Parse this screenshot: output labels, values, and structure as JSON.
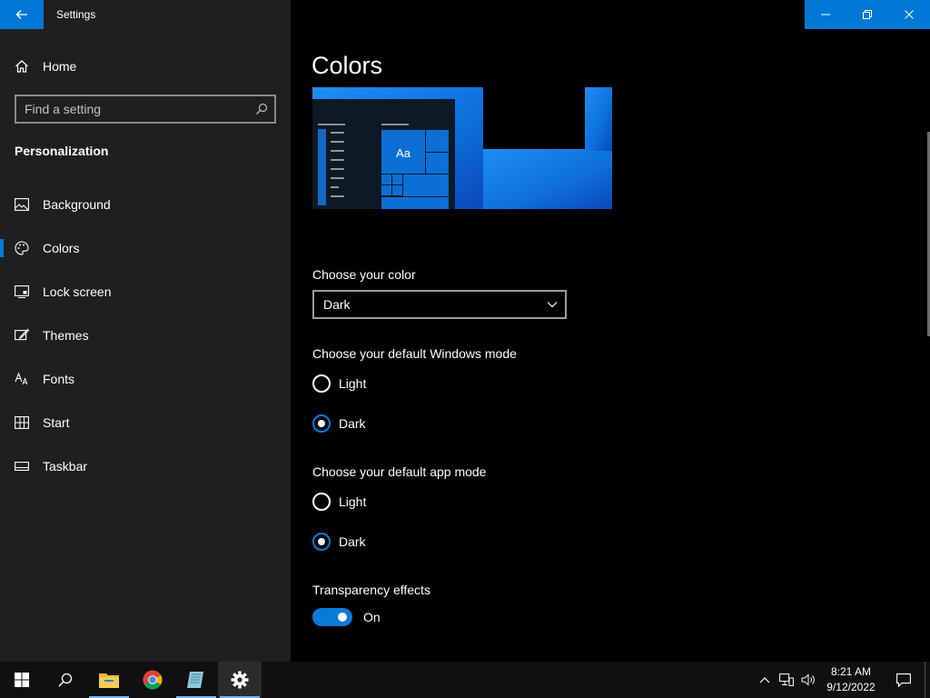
{
  "app": {
    "title": "Settings"
  },
  "sidebar": {
    "home_label": "Home",
    "search_placeholder": "Find a setting",
    "section_title": "Personalization",
    "items": [
      {
        "label": "Background",
        "icon": "picture-icon"
      },
      {
        "label": "Colors",
        "icon": "palette-icon",
        "active": true
      },
      {
        "label": "Lock screen",
        "icon": "lock-screen-icon"
      },
      {
        "label": "Themes",
        "icon": "brush-icon"
      },
      {
        "label": "Fonts",
        "icon": "font-icon"
      },
      {
        "label": "Start",
        "icon": "start-icon"
      },
      {
        "label": "Taskbar",
        "icon": "taskbar-icon"
      }
    ]
  },
  "main": {
    "title": "Colors",
    "preview_sample_text": "Aa",
    "choose_color": {
      "label": "Choose your color",
      "value": "Dark"
    },
    "windows_mode": {
      "label": "Choose your default Windows mode",
      "options": [
        "Light",
        "Dark"
      ],
      "selected": "Dark"
    },
    "app_mode": {
      "label": "Choose your default app mode",
      "options": [
        "Light",
        "Dark"
      ],
      "selected": "Dark"
    },
    "transparency": {
      "label": "Transparency effects",
      "state": "On"
    }
  },
  "taskbar": {
    "apps": [
      "start-icon",
      "search-icon",
      "file-explorer-icon",
      "chrome-icon",
      "notepad-icon",
      "settings-icon"
    ],
    "clock": {
      "time": "8:21 AM",
      "date": "9/12/2022"
    }
  },
  "colors": {
    "accent": "#0078d7",
    "sidebar_bg": "#1f1f1f",
    "main_bg": "#000000",
    "taskbar_bg": "#101010"
  }
}
